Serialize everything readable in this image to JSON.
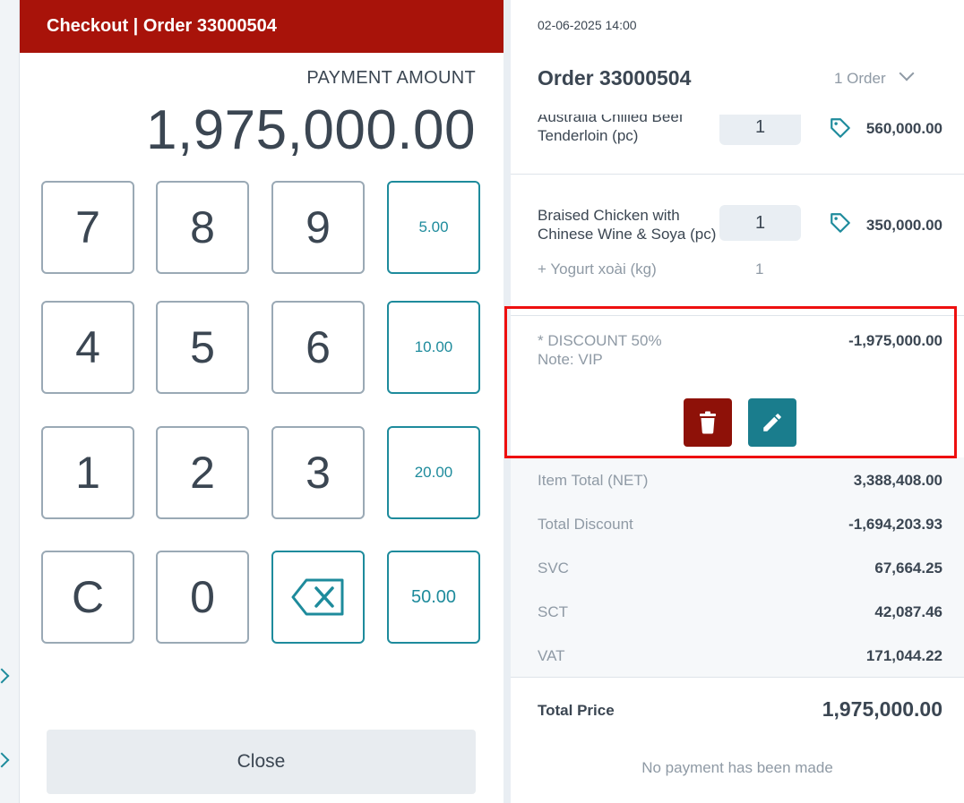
{
  "checkout": {
    "title": "Checkout | Order 33000504",
    "payment_label": "PAYMENT AMOUNT",
    "payment_amount": "1,975,000.00",
    "keys": {
      "k7": "7",
      "k8": "8",
      "k9": "9",
      "k4": "4",
      "k5": "5",
      "k6": "6",
      "k1": "1",
      "k2": "2",
      "k3": "3",
      "kc": "C",
      "k0": "0"
    },
    "quick_amounts": [
      "5.00",
      "10.00",
      "20.00",
      "50.00"
    ],
    "close_label": "Close",
    "backspace_icon": "backspace-icon"
  },
  "order": {
    "datetime": "02-06-2025 14:00",
    "title": "Order 33000504",
    "count": "1 Order",
    "items": [
      {
        "name": "Australia Chilled Beef Tenderloin (pc)",
        "qty": "1",
        "price": "560,000.00"
      },
      {
        "name": "Braised Chicken with Chinese Wine & Soya (pc)",
        "qty": "1",
        "price": "350,000.00"
      }
    ],
    "modifier": {
      "name": "+ Yogurt xoài (kg)",
      "qty": "1"
    },
    "discount": {
      "name": "* DISCOUNT 50%",
      "note": "Note: VIP",
      "value": "-1,975,000.00"
    },
    "summary": [
      {
        "label": "Item Total (NET)",
        "value": "3,388,408.00"
      },
      {
        "label": "Total Discount",
        "value": "-1,694,203.93"
      },
      {
        "label": "SVC",
        "value": "67,664.25"
      },
      {
        "label": "SCT",
        "value": "42,087.46"
      },
      {
        "label": "VAT",
        "value": "171,044.22"
      }
    ],
    "total_label": "Total Price",
    "total_value": "1,975,000.00",
    "no_payment": "No payment has been made"
  },
  "colors": {
    "header_red": "#a8130a",
    "accent_teal": "#1e8b9c",
    "delete_red": "#8e1108",
    "highlight_red": "#ee0f0f"
  }
}
